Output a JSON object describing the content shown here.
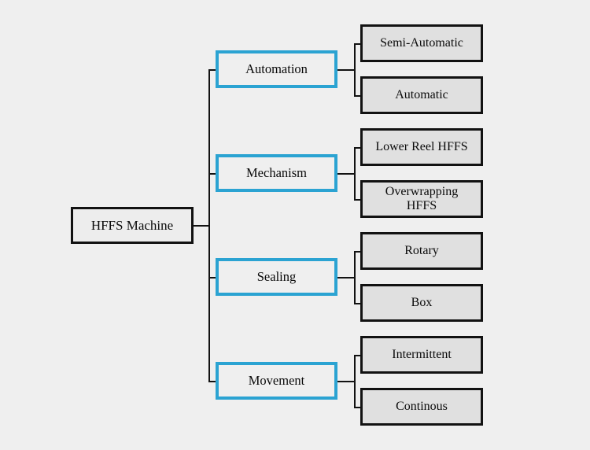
{
  "diagram": {
    "type": "hierarchy-tree",
    "title": "HFFS Machine classification tree",
    "colors": {
      "background": "#efefef",
      "root_border": "#121212",
      "root_fill": "#ededed",
      "category_border": "#2ba3d2",
      "category_fill": "#efefef",
      "leaf_border": "#121212",
      "leaf_fill": "#e0e0e0",
      "connector": "#121212",
      "text": "#0a0a0a"
    },
    "root": {
      "label": "HFFS Machine"
    },
    "categories": [
      {
        "label": "Automation",
        "children": [
          {
            "label": "Semi-Automatic"
          },
          {
            "label": "Automatic"
          }
        ]
      },
      {
        "label": "Mechanism",
        "children": [
          {
            "label": "Lower Reel HFFS"
          },
          {
            "label": "Overwrapping\nHFFS"
          }
        ]
      },
      {
        "label": "Sealing",
        "children": [
          {
            "label": "Rotary"
          },
          {
            "label": "Box"
          }
        ]
      },
      {
        "label": "Movement",
        "children": [
          {
            "label": "Intermittent"
          },
          {
            "label": "Continous"
          }
        ]
      }
    ]
  }
}
